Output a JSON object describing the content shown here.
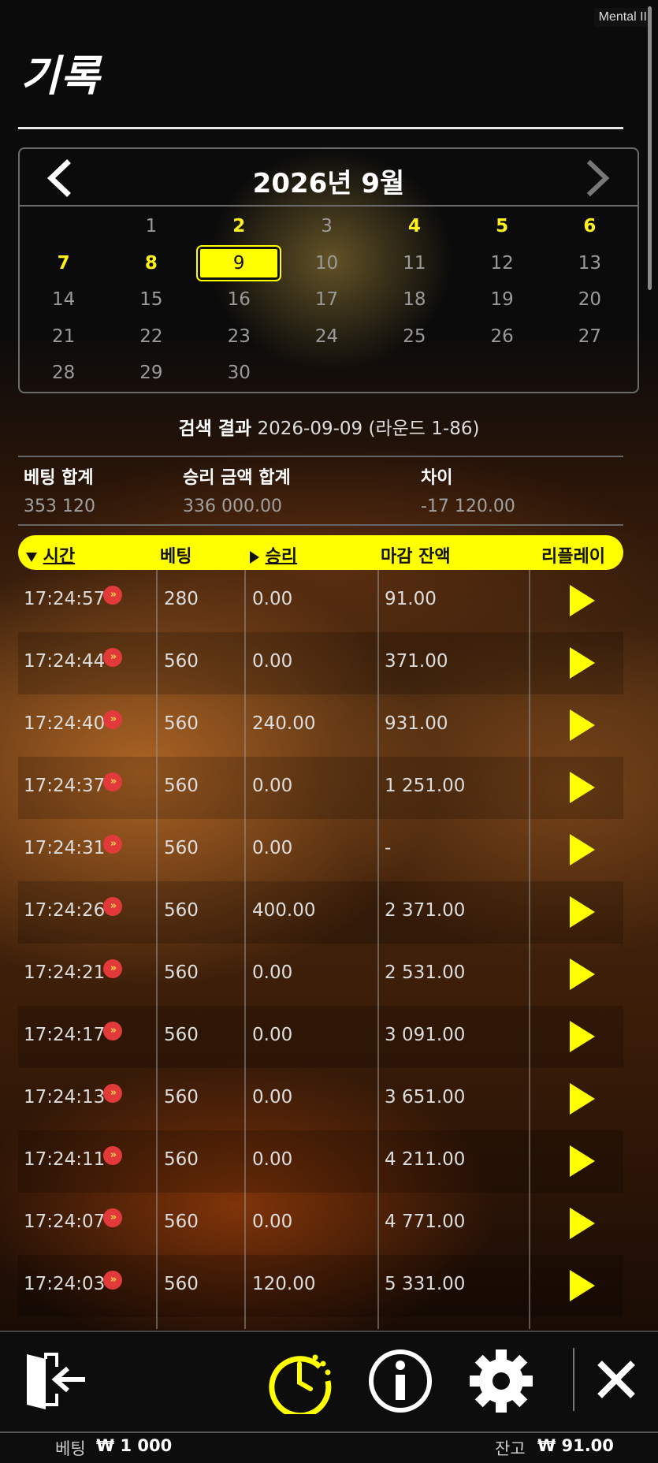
{
  "brand": "Mental II",
  "title": "기록",
  "calendar": {
    "month_label": "2026년 9월",
    "days": [
      {
        "label": "1",
        "col": 1,
        "row": 0,
        "played": false
      },
      {
        "label": "2",
        "col": 2,
        "row": 0,
        "played": true
      },
      {
        "label": "3",
        "col": 3,
        "row": 0,
        "played": false
      },
      {
        "label": "4",
        "col": 4,
        "row": 0,
        "played": true
      },
      {
        "label": "5",
        "col": 5,
        "row": 0,
        "played": true
      },
      {
        "label": "6",
        "col": 6,
        "row": 0,
        "played": true
      },
      {
        "label": "7",
        "col": 0,
        "row": 1,
        "played": true
      },
      {
        "label": "8",
        "col": 1,
        "row": 1,
        "played": true
      },
      {
        "label": "9",
        "col": 2,
        "row": 1,
        "played": true,
        "selected": true
      },
      {
        "label": "10",
        "col": 3,
        "row": 1,
        "played": false
      },
      {
        "label": "11",
        "col": 4,
        "row": 1,
        "played": false
      },
      {
        "label": "12",
        "col": 5,
        "row": 1,
        "played": false
      },
      {
        "label": "13",
        "col": 6,
        "row": 1,
        "played": false
      },
      {
        "label": "14",
        "col": 0,
        "row": 2,
        "played": false
      },
      {
        "label": "15",
        "col": 1,
        "row": 2,
        "played": false
      },
      {
        "label": "16",
        "col": 2,
        "row": 2,
        "played": false
      },
      {
        "label": "17",
        "col": 3,
        "row": 2,
        "played": false
      },
      {
        "label": "18",
        "col": 4,
        "row": 2,
        "played": false
      },
      {
        "label": "19",
        "col": 5,
        "row": 2,
        "played": false
      },
      {
        "label": "20",
        "col": 6,
        "row": 2,
        "played": false
      },
      {
        "label": "21",
        "col": 0,
        "row": 3,
        "played": false
      },
      {
        "label": "22",
        "col": 1,
        "row": 3,
        "played": false
      },
      {
        "label": "23",
        "col": 2,
        "row": 3,
        "played": false
      },
      {
        "label": "24",
        "col": 3,
        "row": 3,
        "played": false
      },
      {
        "label": "25",
        "col": 4,
        "row": 3,
        "played": false
      },
      {
        "label": "26",
        "col": 5,
        "row": 3,
        "played": false
      },
      {
        "label": "27",
        "col": 6,
        "row": 3,
        "played": false
      },
      {
        "label": "28",
        "col": 0,
        "row": 4,
        "played": false
      },
      {
        "label": "29",
        "col": 1,
        "row": 4,
        "played": false
      },
      {
        "label": "30",
        "col": 2,
        "row": 4,
        "played": false
      }
    ]
  },
  "search": {
    "label": "검색 결과",
    "value": "2026-09-09 (라운드 1-86)"
  },
  "summary": {
    "bet_total_label": "베팅 합계",
    "bet_total_value": "353 120",
    "win_total_label": "승리 금액 합계",
    "win_total_value": "336 000.00",
    "diff_label": "차이",
    "diff_value": "-17 120.00"
  },
  "table": {
    "headers": {
      "time": "시간",
      "bet": "베팅",
      "win": "승리",
      "balance": "마감 잔액",
      "replay": "리플레이"
    },
    "rows": [
      {
        "time": "17:24:57",
        "bet": "280",
        "win": "0.00",
        "balance": "91.00"
      },
      {
        "time": "17:24:44",
        "bet": "560",
        "win": "0.00",
        "balance": "371.00"
      },
      {
        "time": "17:24:40",
        "bet": "560",
        "win": "240.00",
        "balance": "931.00"
      },
      {
        "time": "17:24:37",
        "bet": "560",
        "win": "0.00",
        "balance": "1 251.00"
      },
      {
        "time": "17:24:31",
        "bet": "560",
        "win": "0.00",
        "balance": "-"
      },
      {
        "time": "17:24:26",
        "bet": "560",
        "win": "400.00",
        "balance": "2 371.00"
      },
      {
        "time": "17:24:21",
        "bet": "560",
        "win": "0.00",
        "balance": "2 531.00"
      },
      {
        "time": "17:24:17",
        "bet": "560",
        "win": "0.00",
        "balance": "3 091.00"
      },
      {
        "time": "17:24:13",
        "bet": "560",
        "win": "0.00",
        "balance": "3 651.00"
      },
      {
        "time": "17:24:11",
        "bet": "560",
        "win": "0.00",
        "balance": "4 211.00"
      },
      {
        "time": "17:24:07",
        "bet": "560",
        "win": "0.00",
        "balance": "4 771.00"
      },
      {
        "time": "17:24:03",
        "bet": "560",
        "win": "120.00",
        "balance": "5 331.00"
      }
    ]
  },
  "toolbar": {
    "icons": [
      "exit-icon",
      "history-icon",
      "info-icon",
      "settings-icon",
      "close-icon"
    ],
    "active": "history-icon"
  },
  "status": {
    "bet_label": "베팅",
    "bet_value": "₩ 1 000",
    "balance_label": "잔고",
    "balance_value": "₩ 91.00"
  },
  "colors": {
    "accent": "#ffff00",
    "played_day": "#fff21a",
    "turbo_badge": "#e23a3a"
  }
}
